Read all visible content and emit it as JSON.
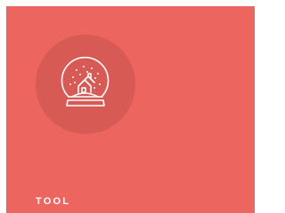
{
  "card": {
    "background_color": "#ec655f",
    "icon": "snow-globe-icon",
    "label": "TOOL"
  }
}
